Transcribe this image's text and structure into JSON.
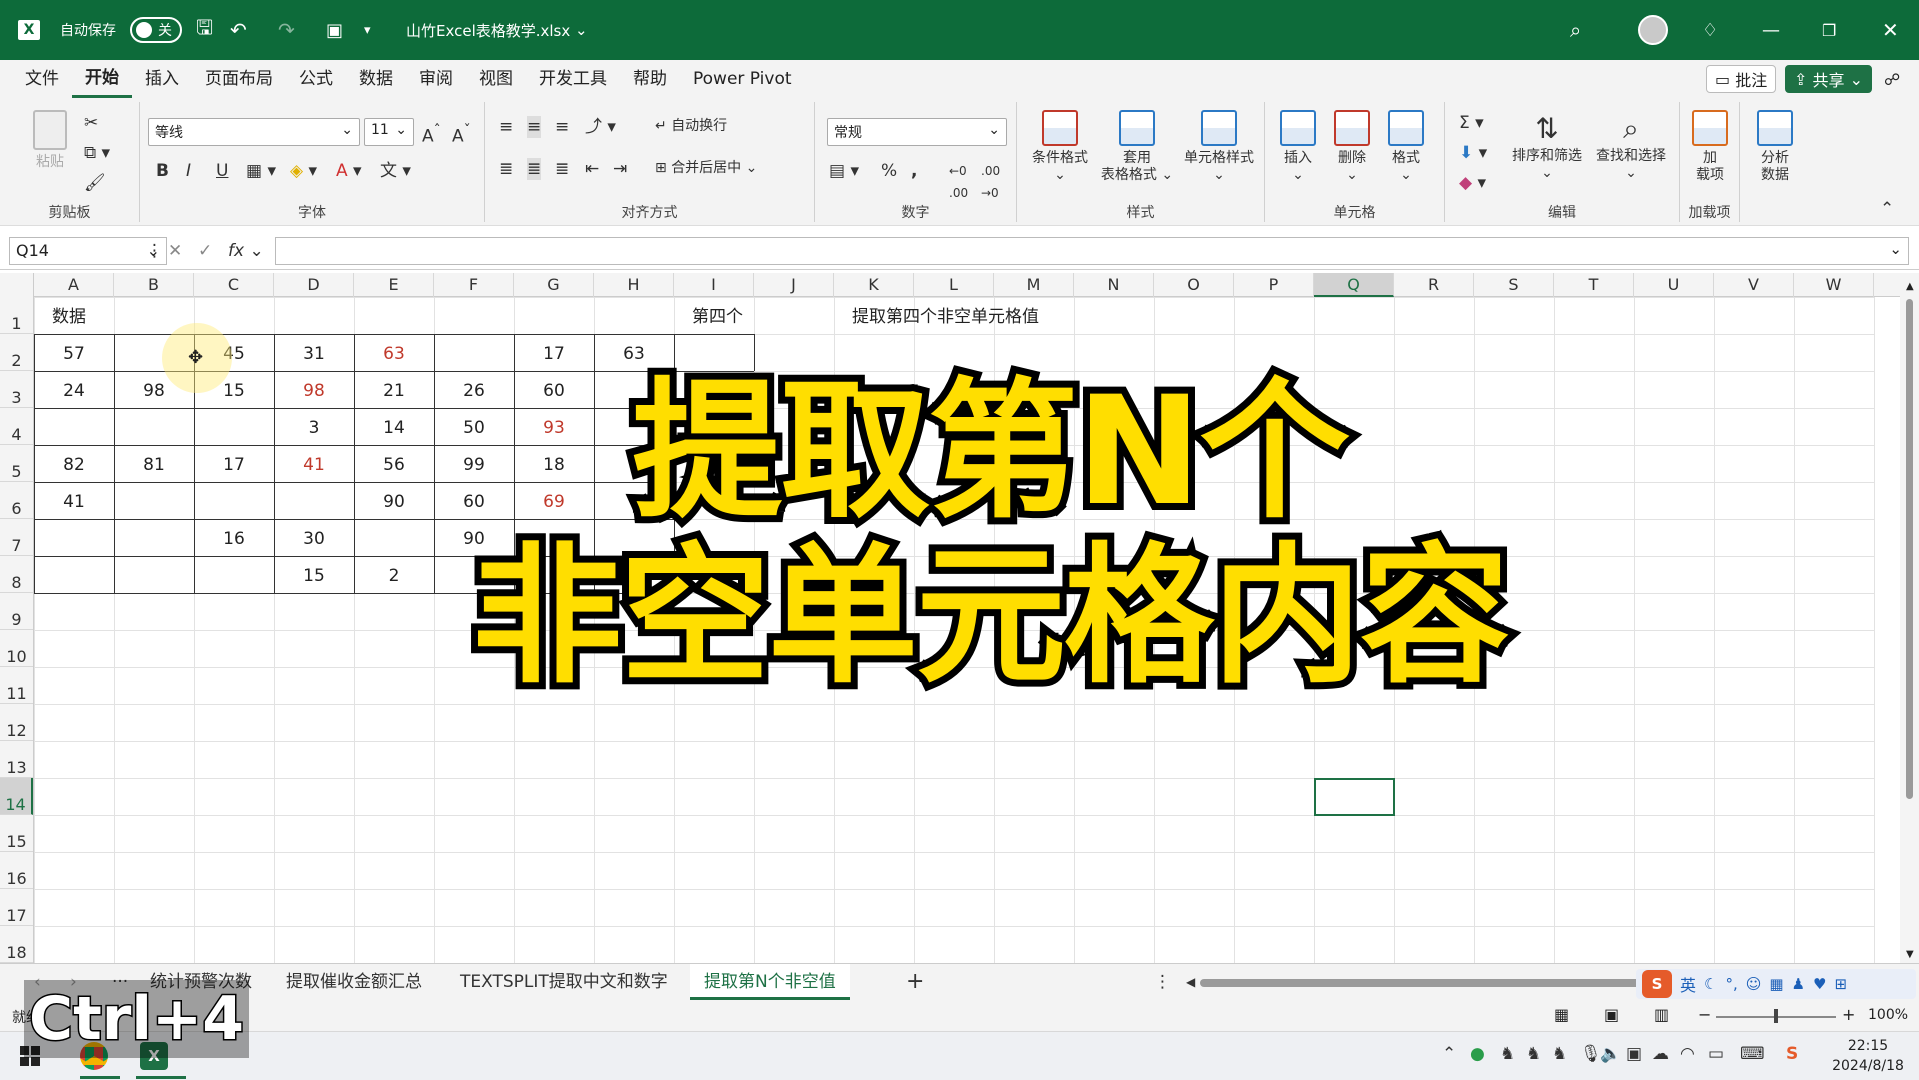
{
  "titlebar": {
    "autosave_label": "自动保存",
    "autosave_state": "关",
    "filename": "山竹Excel表格教学.xlsx"
  },
  "menu": {
    "tabs": [
      "文件",
      "开始",
      "插入",
      "页面布局",
      "公式",
      "数据",
      "审阅",
      "视图",
      "开发工具",
      "帮助",
      "Power Pivot"
    ],
    "active": "开始",
    "comment_btn": "批注",
    "share_btn": "共享"
  },
  "ribbon": {
    "clipboard": {
      "label": "剪贴板",
      "paste": "粘贴"
    },
    "font": {
      "label": "字体",
      "name": "等线",
      "size": "11",
      "bold": "B",
      "italic": "I",
      "underline": "U"
    },
    "alignment": {
      "label": "对齐方式",
      "wrap": "自动换行",
      "merge": "合并后居中"
    },
    "number": {
      "label": "数字",
      "format": "常规"
    },
    "styles": {
      "label": "样式",
      "cond": "条件格式",
      "table_l1": "套用",
      "table_l2": "表格格式",
      "cell": "单元格样式"
    },
    "cells": {
      "label": "单元格",
      "insert": "插入",
      "delete": "删除",
      "format": "格式"
    },
    "editing": {
      "label": "编辑",
      "sort": "排序和筛选",
      "find": "查找和选择"
    },
    "addins": {
      "label": "加载项",
      "addins_l1": "加",
      "addins_l2": "载项",
      "analyze_l1": "分析",
      "analyze_l2": "数据"
    }
  },
  "formula_bar": {
    "name_box": "Q14",
    "fx": "fx",
    "value": ""
  },
  "columns": [
    "A",
    "B",
    "C",
    "D",
    "E",
    "F",
    "G",
    "H",
    "I",
    "J",
    "K",
    "L",
    "M",
    "N",
    "O",
    "P",
    "Q",
    "R",
    "S",
    "T",
    "U",
    "V",
    "W"
  ],
  "rows": [
    "1",
    "2",
    "3",
    "4",
    "5",
    "6",
    "7",
    "8",
    "9",
    "10",
    "11",
    "12",
    "13",
    "14",
    "15",
    "16",
    "17",
    "18"
  ],
  "selected_cell": {
    "col": "Q",
    "row": "14"
  },
  "cells": {
    "A1": "数据",
    "I1": "第四个",
    "K1": "提取第四个非空单元格值",
    "A2": "57",
    "C2": "45",
    "D2": "31",
    "E2": "63",
    "G2": "17",
    "H2": "63",
    "A3": "24",
    "B3": "98",
    "C3": "15",
    "D3": "98",
    "E3": "21",
    "F3": "26",
    "G3": "60",
    "D4": "3",
    "E4": "14",
    "F4": "50",
    "G4": "93",
    "A5": "82",
    "B5": "81",
    "C5": "17",
    "D5": "41",
    "E5": "56",
    "F5": "99",
    "G5": "18",
    "A6": "41",
    "E6": "90",
    "F6": "60",
    "G6": "69",
    "C7": "16",
    "D7": "30",
    "F7": "90",
    "D8": "15",
    "E8": "2"
  },
  "red_cells": [
    "E2",
    "D3",
    "G4",
    "D5",
    "G6"
  ],
  "overlay_title": {
    "line1": "提取第N个",
    "line2": "非空单元格内容"
  },
  "sheet_tabs": [
    "统计预警次数",
    "提取催收金额汇总",
    "TEXTSPLIT提取中文和数字",
    "提取第N个非空值"
  ],
  "active_sheet": "提取第N个非空值",
  "status": {
    "ready": "就绪",
    "zoom": "100%"
  },
  "keystroke_overlay": "Ctrl+4",
  "taskbar": {
    "time": "22:15",
    "date": "2024/8/18",
    "ime": "英"
  }
}
